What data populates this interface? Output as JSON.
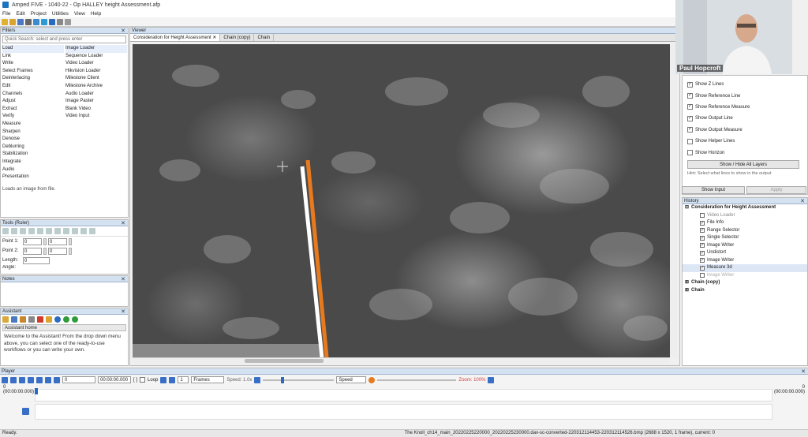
{
  "window": {
    "title": "Amped FIVE - 1040-22 - Op HALLEY height Assessment.afp"
  },
  "menu": [
    "File",
    "Edit",
    "Project",
    "Utilities",
    "View",
    "Help"
  ],
  "filters": {
    "header": "Filters",
    "search_placeholder": "Quick Search: select and press enter",
    "categories": [
      "Load",
      "Link",
      "Write",
      "Select Frames",
      "Deinterlacing",
      "Edit",
      "Channels",
      "Adjust",
      "Extract",
      "Verify",
      "Measure",
      "Sharpen",
      "Denoise",
      "Deblurring",
      "Stabilization",
      "Integrate",
      "Audio",
      "Presentation"
    ],
    "items": [
      "Image Loader",
      "Sequence Loader",
      "Video Loader",
      "Hikvision Loader",
      "Milestone Client",
      "Milestone Archive",
      "Audio Loader",
      "Image Paster",
      "Blank Video",
      "Video Input"
    ],
    "description": "Loads an image from file."
  },
  "tools": {
    "header": "Tools (Ruler)",
    "point1": "Point 1:",
    "point2": "Point 2:",
    "length": "Length:",
    "angle": "Angle:",
    "zero": "0"
  },
  "notes": {
    "header": "Notes"
  },
  "assistant": {
    "header": "Assistant",
    "home": "Assistant home",
    "text": "Welcome to the Assistant! From the drop down menu above, you can select one of the ready-to-use workflows or you can write your own."
  },
  "viewer": {
    "header": "Viewer",
    "tabs": [
      "Consideration for Height Assessment",
      "Chain (copy)",
      "Chain"
    ]
  },
  "webcam": {
    "name": "Paul Hopcroft"
  },
  "measure": {
    "options": [
      {
        "label": "Show Z Lines",
        "checked": true
      },
      {
        "label": "Show Reference Line",
        "checked": true
      },
      {
        "label": "Show Reference Measure",
        "checked": true
      },
      {
        "label": "Show Output Line",
        "checked": true
      },
      {
        "label": "Show Output Measure",
        "checked": true
      },
      {
        "label": "Show Helper Lines",
        "checked": false
      },
      {
        "label": "Show Horizon",
        "checked": false
      }
    ],
    "toggle_button": "Show / Hide All Layers",
    "hint": "Hint: Select what lines to show in the output",
    "show_input": "Show Input",
    "apply": "Apply"
  },
  "history": {
    "header": "History",
    "root": "Consideration for Height Assessment",
    "items": [
      "Video Loader",
      "File Info",
      "Range Selector",
      "Single Selector",
      "Image Writer",
      "Undistort",
      "Image Writer",
      "Measure 3d",
      "Image Writer"
    ],
    "chains": [
      "Chain (copy)",
      "Chain"
    ]
  },
  "player": {
    "header": "Player",
    "frame": "0",
    "time": "00:00:00.000",
    "brackets": "[ ]",
    "loop": "Loop",
    "step": "1",
    "unit": "Frames",
    "speed": "Speed: 1.0x",
    "speed_mode": "Speed",
    "zoom": "Zoom: 100%",
    "start_label": "0",
    "start_time": "(00:00:00.000)",
    "end_label": "0",
    "end_time": "(00:00:00.000)"
  },
  "status": {
    "left": "Ready.",
    "right": "The Knoll_ch14_main_20220225220000_20220225230000.dav-sc-converted-220312114453-220312114526.bmp (2688 x 1520, 1 frame), current: 0"
  },
  "colors": {
    "accent": "#1e73be",
    "measure_line": "#e87a1e"
  }
}
